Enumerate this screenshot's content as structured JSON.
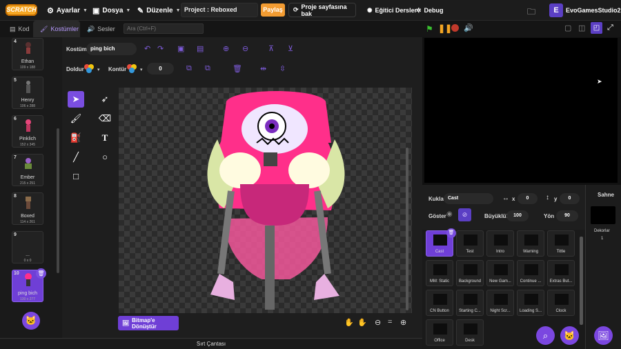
{
  "menubar": {
    "logo": "SCRATCH",
    "settings": "Ayarlar",
    "file": "Dosya",
    "edit": "Düzenle",
    "project_title": "Project : Reboxed",
    "share": "Paylaş",
    "project_page": "Proje sayfasına bak",
    "tutorials": "Eğitici Dersler",
    "debug": "Debug",
    "username": "EvoGamesStudio2"
  },
  "tabs": {
    "code": "Kod",
    "costumes": "Kostümler",
    "sounds": "Sesler"
  },
  "search": {
    "placeholder": "Ara (Ctrl+F)"
  },
  "costumes": [
    {
      "num": "4",
      "name": "Ethan",
      "size": "109 x 188"
    },
    {
      "num": "5",
      "name": "Henry",
      "size": "106 x 288"
    },
    {
      "num": "6",
      "name": "Pinklich",
      "size": "152 x 345"
    },
    {
      "num": "7",
      "name": "Ember",
      "size": "215 x 251"
    },
    {
      "num": "8",
      "name": "Boxed",
      "size": "114 x 261"
    },
    {
      "num": "9",
      "name": "...",
      "size": "0 x 0"
    },
    {
      "num": "10",
      "name": "ping bich",
      "size": "130 x 277"
    }
  ],
  "editor": {
    "costume_label": "Kostüm",
    "costume_name": "ping bich",
    "fill_label": "Doldur",
    "outline_label": "Kontür",
    "outline_width": "0",
    "bitmap_button": "Bitmap'e Dönüştür"
  },
  "backpack": "Sırt Çantası",
  "sprite_info": {
    "sprite_label": "Kukla",
    "sprite_name": "Cast",
    "x": "0",
    "y": "0",
    "show_label": "Göster",
    "size_label": "Büyüklük",
    "size": "100",
    "direction_label": "Yön",
    "direction": "90"
  },
  "sprites": [
    "Cast",
    "Test",
    "Intro",
    "Warning",
    "Tittle",
    "MM: Static",
    "Background",
    "New Gam...",
    "Continue ...",
    "Extras But...",
    "CN Button",
    "Starting C...",
    "Night Scr...",
    "Loading S...",
    "Clock",
    "Office",
    "Desk"
  ],
  "stage_panel": {
    "title": "Sahne",
    "backdrops_label": "Dekorlar",
    "backdrops_count": "1"
  },
  "colors": {
    "accent": "#7a4ee0",
    "share": "#f39c32",
    "character_hair": "#ff2f8a"
  }
}
